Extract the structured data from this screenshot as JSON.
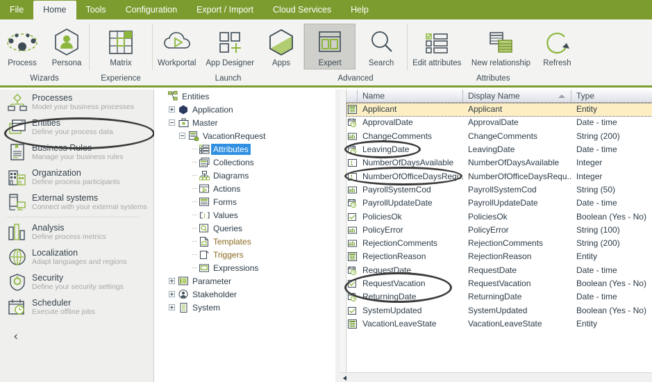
{
  "menubar": {
    "items": [
      {
        "label": "File",
        "active": false
      },
      {
        "label": "Home",
        "active": true
      },
      {
        "label": "Tools",
        "active": false
      },
      {
        "label": "Configuration",
        "active": false
      },
      {
        "label": "Export / Import",
        "active": false
      },
      {
        "label": "Cloud Services",
        "active": false
      },
      {
        "label": "Help",
        "active": false
      }
    ]
  },
  "ribbon": {
    "groups": [
      {
        "caption": "Wizards",
        "buttons": [
          {
            "label": "Process",
            "icon": "process-icon",
            "selected": false
          },
          {
            "label": "Persona",
            "icon": "persona-icon",
            "selected": false
          }
        ]
      },
      {
        "caption": "Experience",
        "buttons": [
          {
            "label": "Matrix",
            "icon": "matrix-icon",
            "selected": false
          }
        ]
      },
      {
        "caption": "Launch",
        "buttons": [
          {
            "label": "Workportal",
            "icon": "workportal-icon",
            "selected": false
          },
          {
            "label": "App Designer",
            "icon": "app-designer-icon",
            "selected": false
          },
          {
            "label": "Apps",
            "icon": "apps-icon",
            "selected": false
          }
        ]
      },
      {
        "caption": "Advanced",
        "buttons": [
          {
            "label": "Expert",
            "icon": "expert-icon",
            "selected": true
          },
          {
            "label": "Search",
            "icon": "search-icon",
            "selected": false
          }
        ]
      },
      {
        "caption": "Attributes",
        "buttons": [
          {
            "label": "Edit attributes",
            "icon": "edit-attributes-icon",
            "selected": false
          },
          {
            "label": "New relationship",
            "icon": "new-relationship-icon",
            "selected": false
          },
          {
            "label": "Refresh",
            "icon": "refresh-icon",
            "selected": false
          }
        ]
      }
    ]
  },
  "sidebar": {
    "items": [
      {
        "title": "Processes",
        "subtitle": "Model your business processes",
        "icon": "processes-icon"
      },
      {
        "title": "Entities",
        "subtitle": "Define your process data",
        "icon": "entities-icon"
      },
      {
        "title": "Business Rules",
        "subtitle": "Manage your business rules",
        "icon": "business-rules-icon"
      },
      {
        "title": "Organization",
        "subtitle": "Define process participants",
        "icon": "organization-icon"
      },
      {
        "title": "External systems",
        "subtitle": "Connect with your external systems",
        "icon": "external-systems-icon"
      },
      {
        "title": "Analysis",
        "subtitle": "Define process metrics",
        "icon": "analysis-icon"
      },
      {
        "title": "Localization",
        "subtitle": "Adapt languages and regions",
        "icon": "localization-icon"
      },
      {
        "title": "Security",
        "subtitle": "Define your security settings",
        "icon": "security-icon"
      },
      {
        "title": "Scheduler",
        "subtitle": "Execute offline jobs",
        "icon": "scheduler-icon"
      }
    ],
    "collapse_glyph": "‹",
    "highlighted_item": "Entities"
  },
  "tree": {
    "nodes": [
      {
        "label": "Entities",
        "depth": 0,
        "expander": "none",
        "icon": "entities-root-icon",
        "selected": false,
        "gold": false
      },
      {
        "label": "Application",
        "depth": 1,
        "expander": "plus",
        "icon": "application-icon",
        "selected": false,
        "gold": false
      },
      {
        "label": "Master",
        "depth": 1,
        "expander": "minus",
        "icon": "master-icon",
        "selected": false,
        "gold": false
      },
      {
        "label": "VacationRequest",
        "depth": 2,
        "expander": "minus",
        "icon": "entity-icon",
        "selected": false,
        "gold": false
      },
      {
        "label": "Attributes",
        "depth": 3,
        "expander": "none",
        "icon": "attributes-icon",
        "selected": true,
        "gold": false
      },
      {
        "label": "Collections",
        "depth": 3,
        "expander": "none",
        "icon": "collections-icon",
        "selected": false,
        "gold": false
      },
      {
        "label": "Diagrams",
        "depth": 3,
        "expander": "none",
        "icon": "diagrams-icon",
        "selected": false,
        "gold": false
      },
      {
        "label": "Actions",
        "depth": 3,
        "expander": "none",
        "icon": "actions-icon",
        "selected": false,
        "gold": false
      },
      {
        "label": "Forms",
        "depth": 3,
        "expander": "none",
        "icon": "forms-icon",
        "selected": false,
        "gold": false
      },
      {
        "label": "Values",
        "depth": 3,
        "expander": "none",
        "icon": "values-icon",
        "selected": false,
        "gold": false
      },
      {
        "label": "Queries",
        "depth": 3,
        "expander": "none",
        "icon": "queries-icon",
        "selected": false,
        "gold": false
      },
      {
        "label": "Templates",
        "depth": 3,
        "expander": "none",
        "icon": "templates-icon",
        "selected": false,
        "gold": true
      },
      {
        "label": "Triggers",
        "depth": 3,
        "expander": "none",
        "icon": "triggers-icon",
        "selected": false,
        "gold": true
      },
      {
        "label": "Expressions",
        "depth": 3,
        "expander": "none",
        "icon": "expressions-icon",
        "selected": false,
        "gold": false
      },
      {
        "label": "Parameter",
        "depth": 1,
        "expander": "plus",
        "icon": "parameter-icon",
        "selected": false,
        "gold": false
      },
      {
        "label": "Stakeholder",
        "depth": 1,
        "expander": "plus",
        "icon": "stakeholder-icon",
        "selected": false,
        "gold": false
      },
      {
        "label": "System",
        "depth": 1,
        "expander": "plus",
        "icon": "system-icon",
        "selected": false,
        "gold": false
      }
    ]
  },
  "grid": {
    "columns": [
      {
        "label": "Name",
        "sorted": false
      },
      {
        "label": "Display Name",
        "sorted": true
      },
      {
        "label": "Type",
        "sorted": false
      }
    ],
    "rows": [
      {
        "name": "Applicant",
        "display_name": "Applicant",
        "type": "Entity",
        "icon": "entity-type-icon",
        "highlighted": true
      },
      {
        "name": "ApprovalDate",
        "display_name": "ApprovalDate",
        "type": "Date - time",
        "icon": "datetime-type-icon",
        "highlighted": false
      },
      {
        "name": "ChangeComments",
        "display_name": "ChangeComments",
        "type": "String (200)",
        "icon": "string-type-icon",
        "highlighted": false
      },
      {
        "name": "LeavingDate",
        "display_name": "LeavingDate",
        "type": "Date - time",
        "icon": "datetime-type-icon",
        "highlighted": false
      },
      {
        "name": "NumberOfDaysAvailable",
        "display_name": "NumberOfDaysAvailable",
        "type": "Integer",
        "icon": "integer-type-icon",
        "highlighted": false
      },
      {
        "name": "NumberOfOfficeDaysRequ...",
        "display_name": "NumberOfOfficeDaysRequ...",
        "type": "Integer",
        "icon": "integer-type-icon",
        "highlighted": false
      },
      {
        "name": "PayrollSystemCod",
        "display_name": "PayrollSystemCod",
        "type": "String (50)",
        "icon": "string-type-icon",
        "highlighted": false
      },
      {
        "name": "PayrollUpdateDate",
        "display_name": "PayrollUpdateDate",
        "type": "Date - time",
        "icon": "datetime-type-icon",
        "highlighted": false
      },
      {
        "name": "PoliciesOk",
        "display_name": "PoliciesOk",
        "type": "Boolean (Yes - No)",
        "icon": "boolean-type-icon",
        "highlighted": false
      },
      {
        "name": "PolicyError",
        "display_name": "PolicyError",
        "type": "String (100)",
        "icon": "string-type-icon",
        "highlighted": false
      },
      {
        "name": "RejectionComments",
        "display_name": "RejectionComments",
        "type": "String (200)",
        "icon": "string-type-icon",
        "highlighted": false
      },
      {
        "name": "RejectionReason",
        "display_name": "RejectionReason",
        "type": "Entity",
        "icon": "entity-type-icon",
        "highlighted": false
      },
      {
        "name": "RequestDate",
        "display_name": "RequestDate",
        "type": "Date - time",
        "icon": "datetime-type-icon",
        "highlighted": false
      },
      {
        "name": "RequestVacation",
        "display_name": "RequestVacation",
        "type": "Boolean (Yes - No)",
        "icon": "boolean-type-icon",
        "highlighted": false
      },
      {
        "name": "ReturningDate",
        "display_name": "ReturningDate",
        "type": "Date - time",
        "icon": "datetime-type-icon",
        "highlighted": false
      },
      {
        "name": "SystemUpdated",
        "display_name": "SystemUpdated",
        "type": "Boolean (Yes - No)",
        "icon": "boolean-type-icon",
        "highlighted": false
      },
      {
        "name": "VacationLeaveState",
        "display_name": "VacationLeaveState",
        "type": "Entity",
        "icon": "entity-type-icon",
        "highlighted": false
      }
    ],
    "annotation_circles": [
      "LeavingDate",
      "NumberOfOfficeDaysRequ...",
      "RequestVacation",
      "ReturningDate"
    ]
  },
  "colors": {
    "brand_green": "#7d9c2f",
    "accent_green": "#8cb63c",
    "dark_slate": "#3d4b55",
    "selection_blue": "#2f8fe0",
    "row_highlight": "#fdeec3",
    "annotation": "#3b3b3b"
  },
  "scrollbar": {
    "left_arrow_glyph": "◁"
  }
}
